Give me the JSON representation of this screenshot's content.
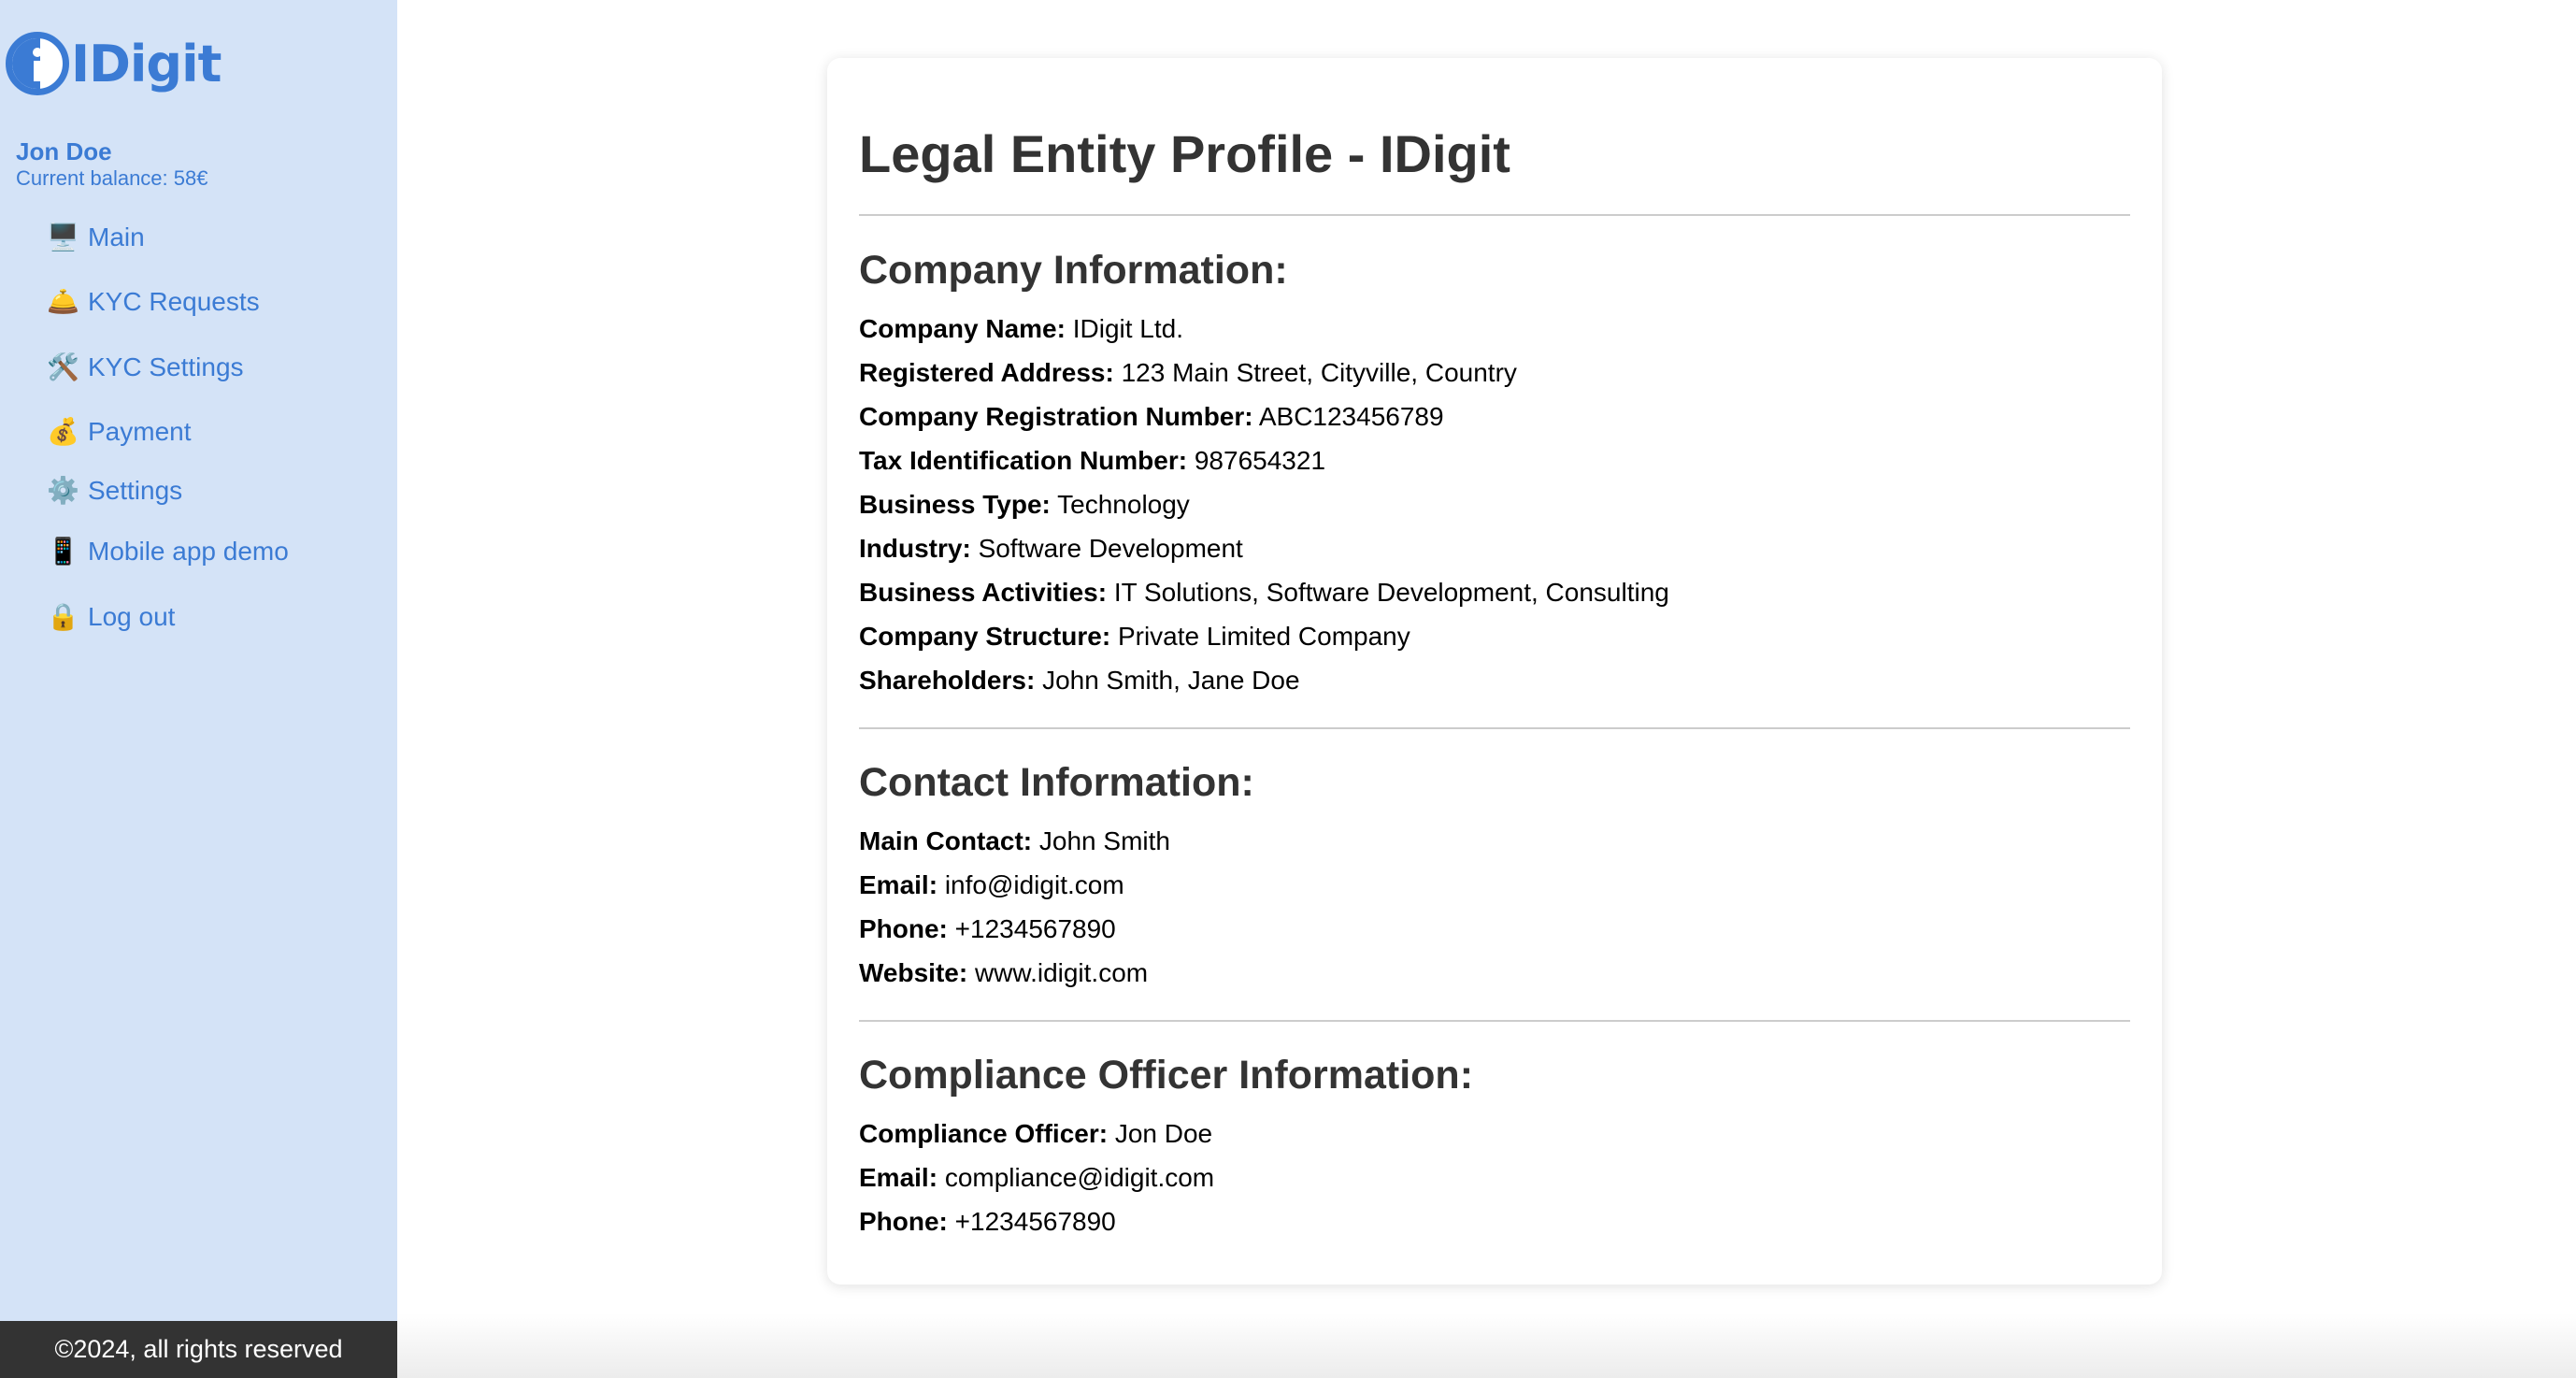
{
  "brand": {
    "name": "IDigit"
  },
  "user": {
    "name": "Jon Doe",
    "balance": "Current balance: 58€"
  },
  "sidebar": {
    "items": [
      {
        "icon": "🖥️",
        "icon_name": "desktop-computer-icon",
        "label": "Main"
      },
      {
        "icon": "🛎️",
        "icon_name": "bellhop-bell-icon",
        "label": "KYC Requests"
      },
      {
        "icon": "🛠️",
        "icon_name": "tools-icon",
        "label": "KYC Settings"
      },
      {
        "icon": "💰",
        "icon_name": "money-bag-icon",
        "label": "Payment"
      },
      {
        "icon": "⚙️",
        "icon_name": "gear-icon",
        "label": "Settings"
      },
      {
        "icon": "📱",
        "icon_name": "mobile-phone-icon",
        "label": "Mobile app demo"
      },
      {
        "icon": "🔒",
        "icon_name": "lock-icon",
        "label": "Log out"
      }
    ]
  },
  "footer": {
    "text": "©2024, all rights reserved"
  },
  "main": {
    "title": "Legal Entity Profile - IDigit",
    "sections": [
      {
        "title": "Company Information:",
        "fields": [
          {
            "label": "Company Name:",
            "value": "IDigit Ltd."
          },
          {
            "label": "Registered Address:",
            "value": "123 Main Street, Cityville, Country"
          },
          {
            "label": "Company Registration Number:",
            "value": "ABC123456789"
          },
          {
            "label": "Tax Identification Number:",
            "value": "987654321"
          },
          {
            "label": "Business Type:",
            "value": "Technology"
          },
          {
            "label": "Industry:",
            "value": "Software Development"
          },
          {
            "label": "Business Activities:",
            "value": "IT Solutions, Software Development, Consulting"
          },
          {
            "label": "Company Structure:",
            "value": "Private Limited Company"
          },
          {
            "label": "Shareholders:",
            "value": "John Smith, Jane Doe"
          }
        ]
      },
      {
        "title": "Contact Information:",
        "fields": [
          {
            "label": "Main Contact:",
            "value": "John Smith"
          },
          {
            "label": "Email:",
            "value": "info@idigit.com"
          },
          {
            "label": "Phone:",
            "value": "+1234567890"
          },
          {
            "label": "Website:",
            "value": "www.idigit.com"
          }
        ]
      },
      {
        "title": "Compliance Officer Information:",
        "fields": [
          {
            "label": "Compliance Officer:",
            "value": "Jon Doe"
          },
          {
            "label": "Email:",
            "value": "compliance@idigit.com"
          },
          {
            "label": "Phone:",
            "value": "+1234567890"
          }
        ]
      }
    ]
  },
  "colors": {
    "accent": "#3b7bd4",
    "sidebar_bg": "#d4e3f7",
    "footer_bg": "#333333",
    "heading": "#333333"
  }
}
